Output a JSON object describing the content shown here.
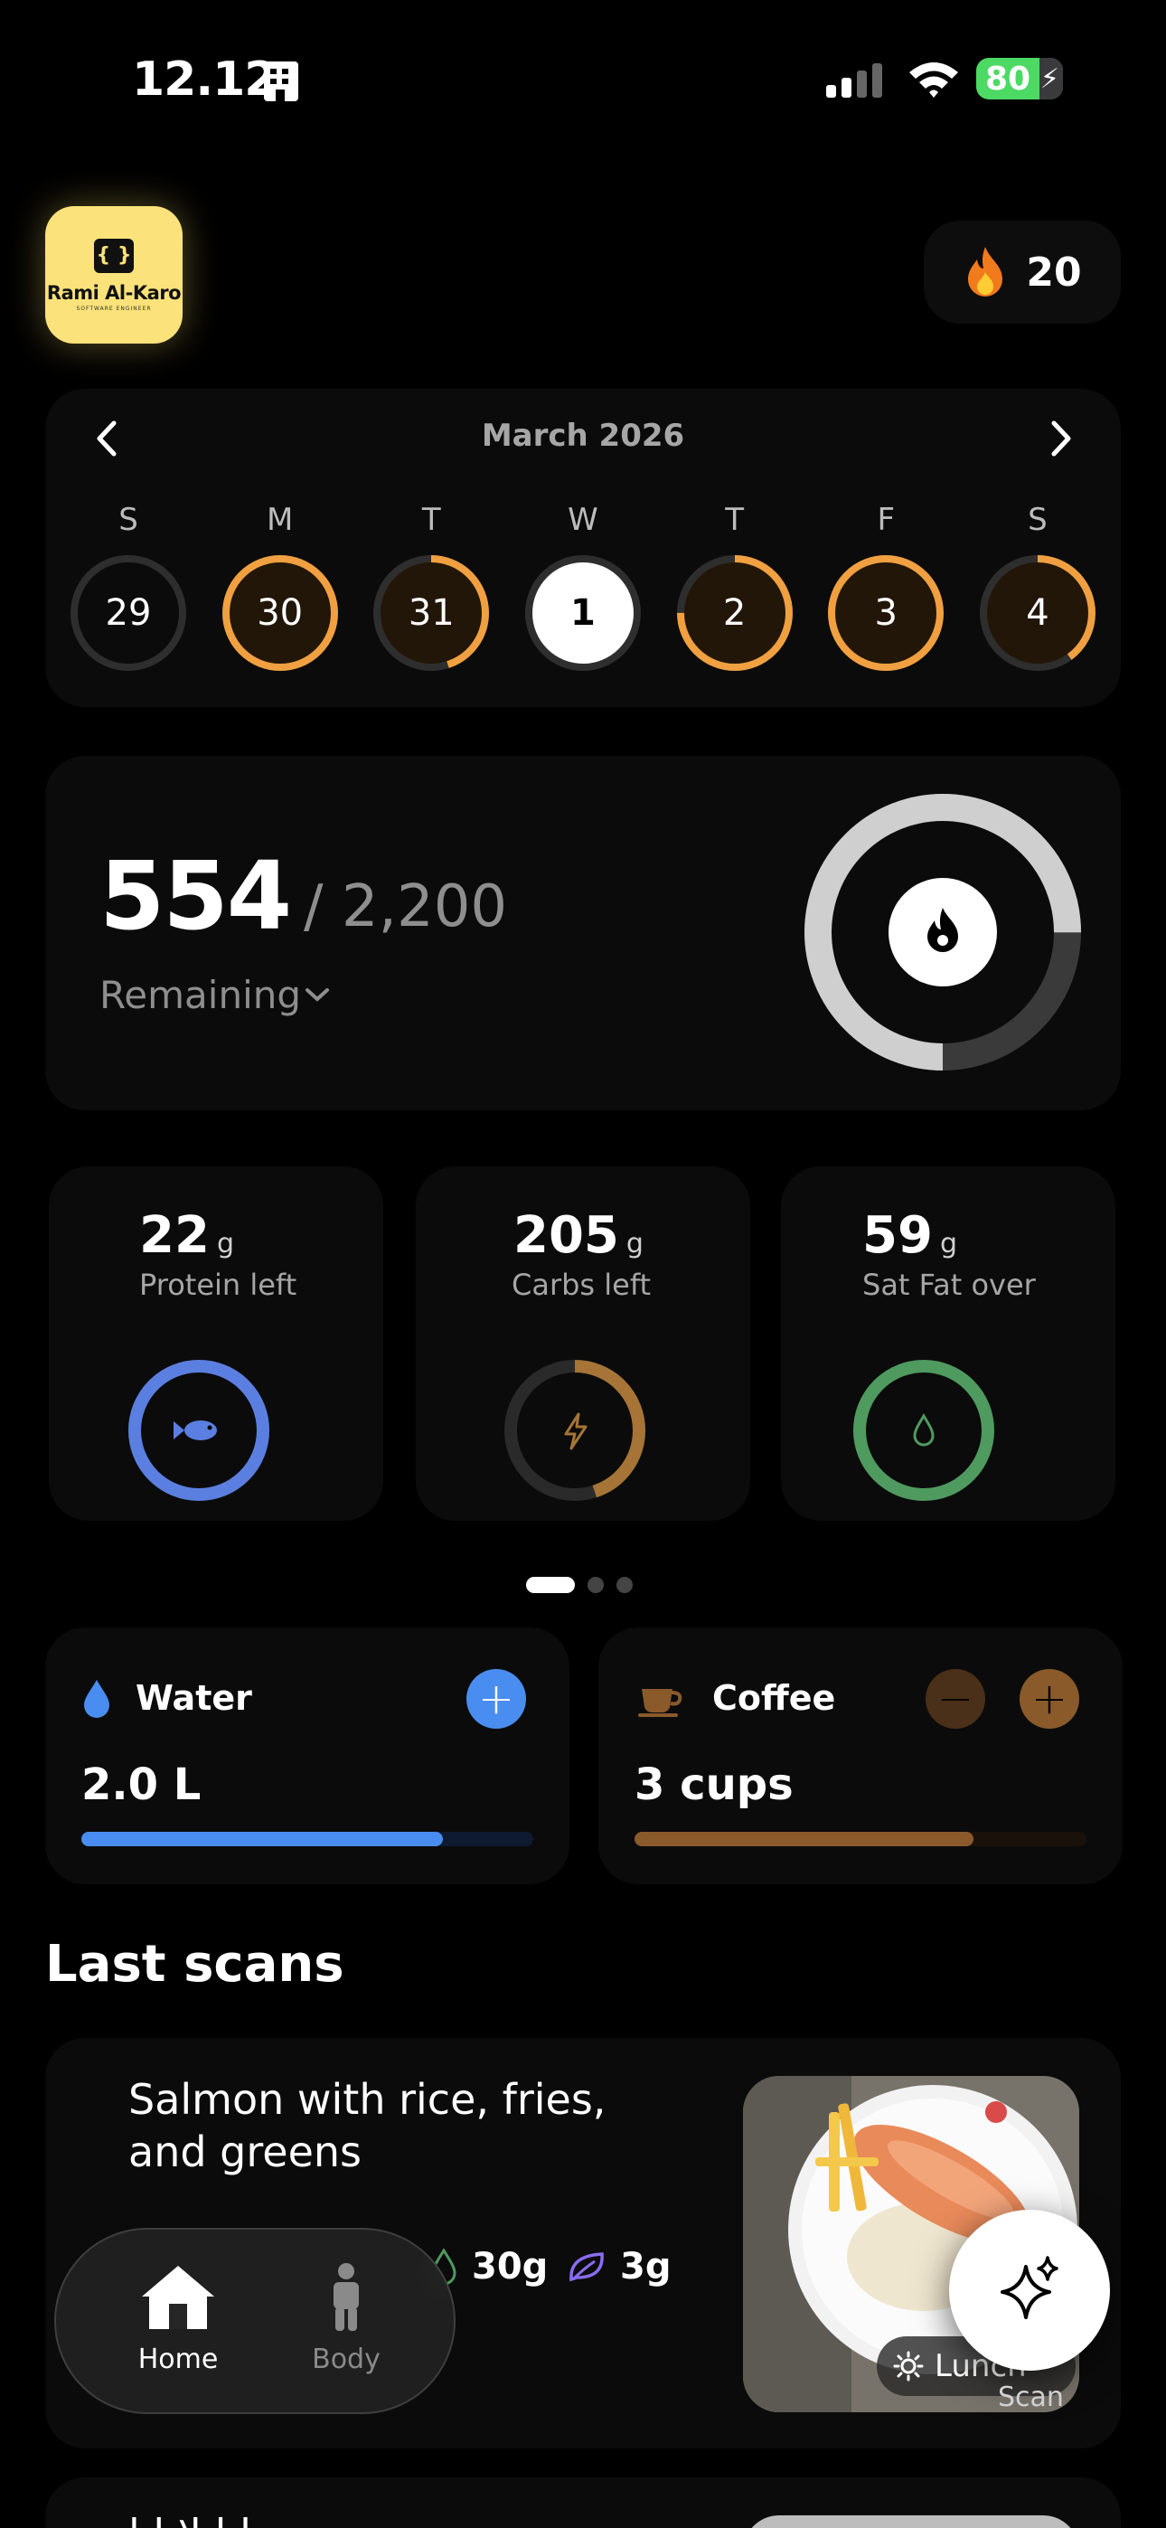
{
  "status_bar": {
    "time": "12.12",
    "battery": "80"
  },
  "header": {
    "logo_text": "Rami Al-Karo",
    "logo_subtext": "SOFTWARE ENGINEER",
    "streak_count": "20"
  },
  "calendar": {
    "month": "March 2026",
    "day_names": [
      "S",
      "M",
      "T",
      "W",
      "T",
      "F",
      "S"
    ],
    "dates": [
      {
        "day": "29",
        "progress": 0,
        "selected": false
      },
      {
        "day": "30",
        "progress": 1.0,
        "selected": false
      },
      {
        "day": "31",
        "progress": 0.45,
        "selected": false
      },
      {
        "day": "1",
        "progress": 0,
        "selected": true
      },
      {
        "day": "2",
        "progress": 0.75,
        "selected": false
      },
      {
        "day": "3",
        "progress": 1.0,
        "selected": false
      },
      {
        "day": "4",
        "progress": 0.4,
        "selected": false
      }
    ]
  },
  "calories": {
    "remaining": "554",
    "goal": "/ 2,200",
    "label": "Remaining",
    "progress": 0.75
  },
  "macros": [
    {
      "value": "22",
      "unit": "g",
      "label": "Protein left",
      "color": "#5b7fe0",
      "progress": 1.0,
      "icon": "fish-icon"
    },
    {
      "value": "205",
      "unit": "g",
      "label": "Carbs left",
      "color": "#a57436",
      "progress": 0.45,
      "icon": "bolt-icon"
    },
    {
      "value": "59",
      "unit": "g",
      "label": "Sat Fat over",
      "color": "#4f9a5f",
      "progress": 1.0,
      "icon": "drop-icon"
    }
  ],
  "pager": {
    "count": 3,
    "active": 0
  },
  "water": {
    "title": "Water",
    "amount": "2.0 L",
    "progress": 0.8,
    "color": "#4a8df0"
  },
  "coffee": {
    "title": "Coffee",
    "amount": "3 cups",
    "progress": 0.75,
    "color": "#8a5a2b"
  },
  "last_scans": {
    "title": "Last scans",
    "items": [
      {
        "name": "Salmon with rice, fries, and greens",
        "fat": "30g",
        "fiber": "3g",
        "meal": "Lunch"
      }
    ],
    "next_preview": "ا  ا  لا  ا  ا"
  },
  "nav": {
    "home": "Home",
    "body": "Body"
  },
  "fab": {
    "label": "Scan"
  },
  "colors": {
    "accent_orange": "#f0a040",
    "card": "#0b0b0b",
    "bg": "#000000"
  }
}
